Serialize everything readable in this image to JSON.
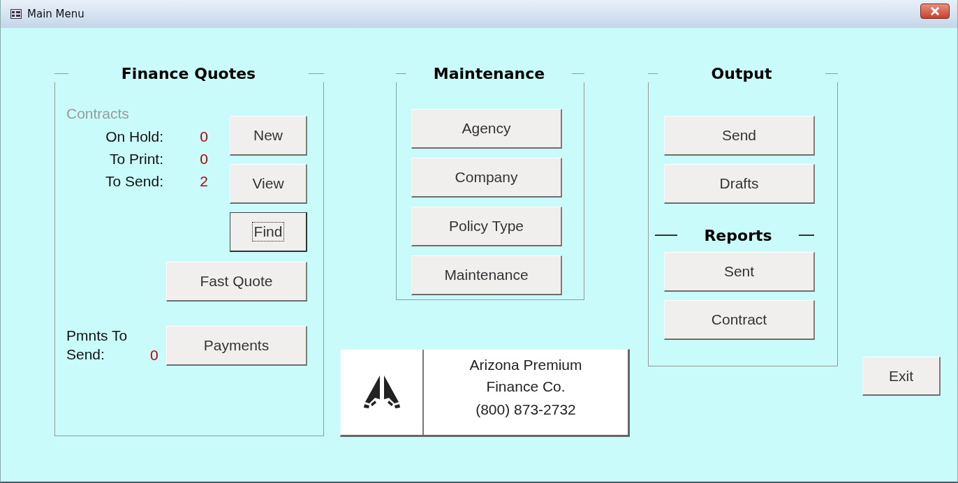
{
  "window": {
    "title": "Main Menu"
  },
  "finance_quotes": {
    "title": "Finance Quotes",
    "contracts_heading": "Contracts",
    "stats": [
      {
        "label": "On Hold:",
        "value": "0"
      },
      {
        "label": "To Print:",
        "value": "0"
      },
      {
        "label": "To Send:",
        "value": "2"
      }
    ],
    "buttons": [
      {
        "label": "New",
        "focused": false
      },
      {
        "label": "View",
        "focused": false
      },
      {
        "label": "Find",
        "focused": true
      }
    ],
    "fast_quote_button": {
      "label": "Fast Quote",
      "focused": false
    },
    "payments": {
      "label": "Pmnts To Send:",
      "value": "0",
      "button": {
        "label": "Payments",
        "focused": false
      }
    }
  },
  "maintenance": {
    "title": "Maintenance",
    "buttons": [
      {
        "label": "Agency",
        "focused": false
      },
      {
        "label": "Company",
        "focused": false
      },
      {
        "label": "Policy Type",
        "focused": false
      },
      {
        "label": "Maintenance",
        "focused": false
      }
    ]
  },
  "company": {
    "name": "Arizona Premium Finance Co.",
    "phone": "(800) 873-2732"
  },
  "output": {
    "title": "Output",
    "buttons": [
      {
        "label": "Send",
        "focused": false
      },
      {
        "label": "Drafts",
        "focused": false
      }
    ],
    "reports_title": "Reports",
    "reports": [
      {
        "label": "Sent",
        "focused": false
      },
      {
        "label": "Contract",
        "focused": false
      }
    ]
  },
  "exit_button": {
    "label": "Exit",
    "focused": false
  }
}
